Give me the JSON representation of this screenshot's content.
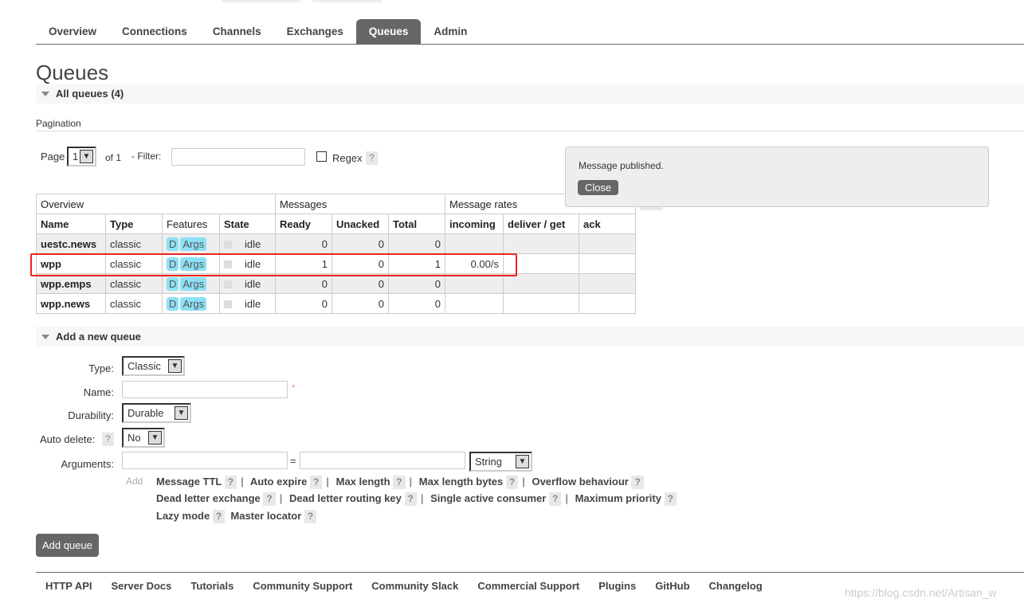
{
  "nav": {
    "tabs": [
      "Overview",
      "Connections",
      "Channels",
      "Exchanges",
      "Queues",
      "Admin"
    ],
    "active": "Queues"
  },
  "page_title": "Queues",
  "all_queues": "All queues (4)",
  "pagination": {
    "heading": "Pagination",
    "page_label": "Page",
    "page_value": "1",
    "of": "of 1",
    "filter_label": "- Filter:",
    "filter_value": "",
    "regex_label": "Regex",
    "help": "?"
  },
  "table": {
    "groups": [
      "Overview",
      "Messages",
      "Message rates"
    ],
    "plusminus": "+/-",
    "columns": [
      "Name",
      "Type",
      "Features",
      "State",
      "Ready",
      "Unacked",
      "Total",
      "incoming",
      "deliver / get",
      "ack"
    ],
    "rows": [
      {
        "name": "uestc.news",
        "type": "classic",
        "f1": "D",
        "f2": "Args",
        "state": "idle",
        "ready": "0",
        "unacked": "0",
        "total": "0",
        "incoming": "",
        "deliver": "",
        "ack": ""
      },
      {
        "name": "wpp",
        "type": "classic",
        "f1": "D",
        "f2": "Args",
        "state": "idle",
        "ready": "1",
        "unacked": "0",
        "total": "1",
        "incoming": "0.00/s",
        "deliver": "",
        "ack": ""
      },
      {
        "name": "wpp.emps",
        "type": "classic",
        "f1": "D",
        "f2": "Args",
        "state": "idle",
        "ready": "0",
        "unacked": "0",
        "total": "0",
        "incoming": "",
        "deliver": "",
        "ack": ""
      },
      {
        "name": "wpp.news",
        "type": "classic",
        "f1": "D",
        "f2": "Args",
        "state": "idle",
        "ready": "0",
        "unacked": "0",
        "total": "0",
        "incoming": "",
        "deliver": "",
        "ack": ""
      }
    ]
  },
  "popup": {
    "message": "Message published.",
    "close": "Close"
  },
  "add_queue": {
    "heading": "Add a new queue",
    "type_label": "Type:",
    "type_value": "Classic",
    "name_label": "Name:",
    "name_value": "",
    "required": "*",
    "durability_label": "Durability:",
    "durability_value": "Durable",
    "auto_delete_label": "Auto delete:",
    "auto_delete_value": "No",
    "arguments_label": "Arguments:",
    "eq": "=",
    "arg_type": "String",
    "add": "Add",
    "arg_links": [
      "Message TTL",
      "Auto expire",
      "Max length",
      "Max length bytes",
      "Overflow behaviour",
      "Dead letter exchange",
      "Dead letter routing key",
      "Single active consumer",
      "Maximum priority",
      "Lazy mode",
      "Master locator"
    ],
    "submit": "Add queue"
  },
  "footer": [
    "HTTP API",
    "Server Docs",
    "Tutorials",
    "Community Support",
    "Community Slack",
    "Commercial Support",
    "Plugins",
    "GitHub",
    "Changelog"
  ],
  "watermark": "https://blog.csdn.net/Artisan_w"
}
